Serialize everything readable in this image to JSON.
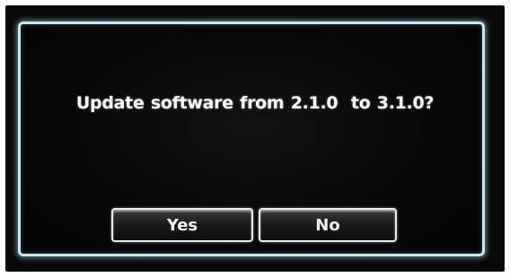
{
  "dialog": {
    "message": "Update software from 2.1.0  to 3.1.0?",
    "yes_label": "Yes",
    "no_label": "No"
  },
  "colors": {
    "screen_background": "#070708",
    "border_glow": "#cfe6ee",
    "text": "#f4f6f6"
  }
}
